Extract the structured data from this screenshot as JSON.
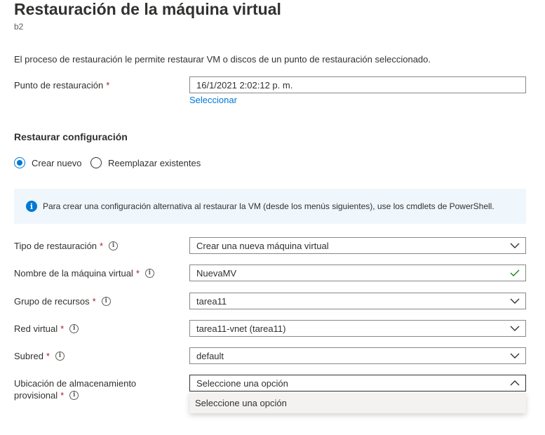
{
  "header": {
    "title": "Restauración de la máquina virtual",
    "subtitle": "b2"
  },
  "description": "El proceso de restauración le permite restaurar VM o discos de un punto de restauración seleccionado.",
  "restore_point": {
    "label": "Punto de restauración",
    "required": "*",
    "value": "16/1/2021 2:02:12 p. m.",
    "select_link": "Seleccionar"
  },
  "config": {
    "section_title": "Restaurar configuración",
    "options": [
      {
        "label": "Crear nuevo",
        "selected": true
      },
      {
        "label": "Reemplazar existentes",
        "selected": false
      }
    ]
  },
  "banner": {
    "icon": "info-icon",
    "text": "Para crear una configuración alternativa al restaurar la VM (desde los menús siguientes), use los cmdlets de PowerShell."
  },
  "form": {
    "restore_type": {
      "label": "Tipo de restauración",
      "required": "*",
      "value": "Crear una nueva máquina virtual"
    },
    "vm_name": {
      "label": "Nombre de la máquina virtual",
      "required": "*",
      "value": "NuevaMV"
    },
    "resource_group": {
      "label": "Grupo de recursos",
      "required": "*",
      "value": "tarea11"
    },
    "vnet": {
      "label": "Red virtual",
      "required": "*",
      "value": "tarea11-vnet (tarea11)"
    },
    "subnet": {
      "label": "Subred",
      "required": "*",
      "value": "default"
    },
    "staging": {
      "label_line1": "Ubicación de almacenamiento",
      "label_line2": "provisional",
      "required": "*",
      "value": "Seleccione una opción"
    }
  },
  "staging_dropdown": {
    "options": [
      "Seleccione una opción"
    ]
  },
  "colors": {
    "accent": "#0078d4",
    "required": "#a4262c",
    "banner_bg": "#eff6fc",
    "valid_check": "#107c10"
  }
}
